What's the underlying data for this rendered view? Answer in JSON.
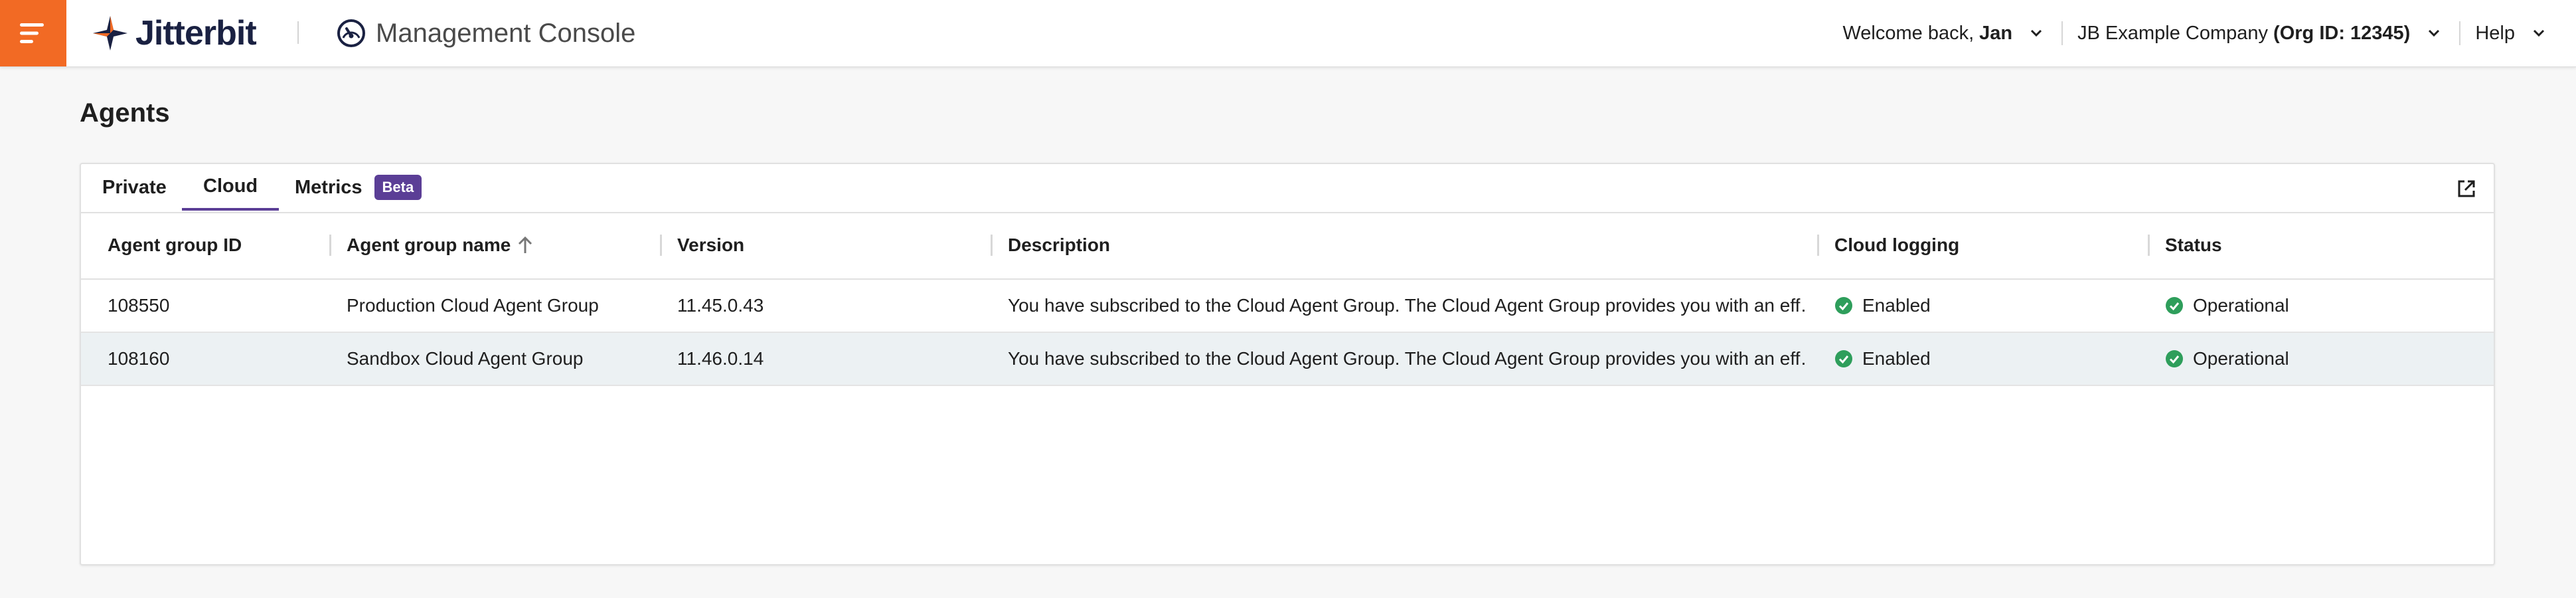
{
  "header": {
    "logo_text": "Jitterbit",
    "console_title": "Management Console",
    "welcome_prefix": "Welcome back,",
    "user_name": "Jan",
    "company_name": "JB Example Company",
    "org_id": "(Org ID: 12345)",
    "help_label": "Help"
  },
  "page": {
    "title": "Agents"
  },
  "tabs": [
    {
      "label": "Private",
      "active": false
    },
    {
      "label": "Cloud",
      "active": true
    },
    {
      "label": "Metrics",
      "active": false,
      "badge": "Beta"
    }
  ],
  "table": {
    "columns": [
      "Agent group ID",
      "Agent group name",
      "Version",
      "Description",
      "Cloud logging",
      "Status"
    ],
    "sorted_column": "Agent group name",
    "rows": [
      {
        "id": "108550",
        "name": "Production Cloud Agent Group",
        "version": "11.45.0.43",
        "description": "You have subscribed to the Cloud Agent Group. The Cloud Agent Group provides you with an eff…",
        "logging": "Enabled",
        "status": "Operational"
      },
      {
        "id": "108160",
        "name": "Sandbox Cloud Agent Group",
        "version": "11.46.0.14",
        "description": "You have subscribed to the Cloud Agent Group. The Cloud Agent Group provides you with an eff…",
        "logging": "Enabled",
        "status": "Operational"
      }
    ]
  },
  "colors": {
    "brand_orange": "#f26a24",
    "accent_purple": "#5b3e96",
    "status_green": "#2e9e5b",
    "logo_navy": "#1a2142"
  },
  "icons": [
    "hamburger-icon",
    "jitterbit-logo-icon",
    "gauge-icon",
    "chevron-down-icon",
    "sort-arrow-up-icon",
    "open-external-icon",
    "check-circle-icon"
  ]
}
